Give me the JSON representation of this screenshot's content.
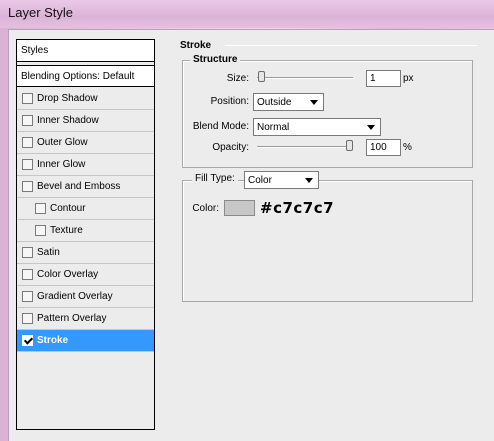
{
  "window": {
    "title": "Layer Style"
  },
  "styles_panel": {
    "header": "Styles",
    "blending_options": "Blending Options: Default",
    "items": [
      {
        "label": "Drop Shadow",
        "checked": false,
        "indent": false,
        "selected": false
      },
      {
        "label": "Inner Shadow",
        "checked": false,
        "indent": false,
        "selected": false
      },
      {
        "label": "Outer Glow",
        "checked": false,
        "indent": false,
        "selected": false
      },
      {
        "label": "Inner Glow",
        "checked": false,
        "indent": false,
        "selected": false
      },
      {
        "label": "Bevel and Emboss",
        "checked": false,
        "indent": false,
        "selected": false
      },
      {
        "label": "Contour",
        "checked": false,
        "indent": true,
        "selected": false
      },
      {
        "label": "Texture",
        "checked": false,
        "indent": true,
        "selected": false
      },
      {
        "label": "Satin",
        "checked": false,
        "indent": false,
        "selected": false
      },
      {
        "label": "Color Overlay",
        "checked": false,
        "indent": false,
        "selected": false
      },
      {
        "label": "Gradient Overlay",
        "checked": false,
        "indent": false,
        "selected": false
      },
      {
        "label": "Pattern Overlay",
        "checked": false,
        "indent": false,
        "selected": false
      },
      {
        "label": "Stroke",
        "checked": true,
        "indent": false,
        "selected": true
      }
    ]
  },
  "stroke": {
    "section_title": "Stroke",
    "structure_title": "Structure",
    "size": {
      "label": "Size:",
      "value": "1",
      "unit": "px",
      "slider_fraction": 0.01
    },
    "position": {
      "label": "Position:",
      "value": "Outside"
    },
    "blend_mode": {
      "label": "Blend Mode:",
      "value": "Normal"
    },
    "opacity": {
      "label": "Opacity:",
      "value": "100",
      "unit": "%",
      "slider_fraction": 1.0
    },
    "fill_type": {
      "label": "Fill Type:",
      "value": "Color"
    },
    "color": {
      "label": "Color:",
      "swatch_hex": "#c7c7c7",
      "annotation": "#c7c7c7"
    }
  },
  "colors": {
    "selection": "#3399ff",
    "panel_bg": "#ececec",
    "title_bar": "#dcb3d8"
  }
}
